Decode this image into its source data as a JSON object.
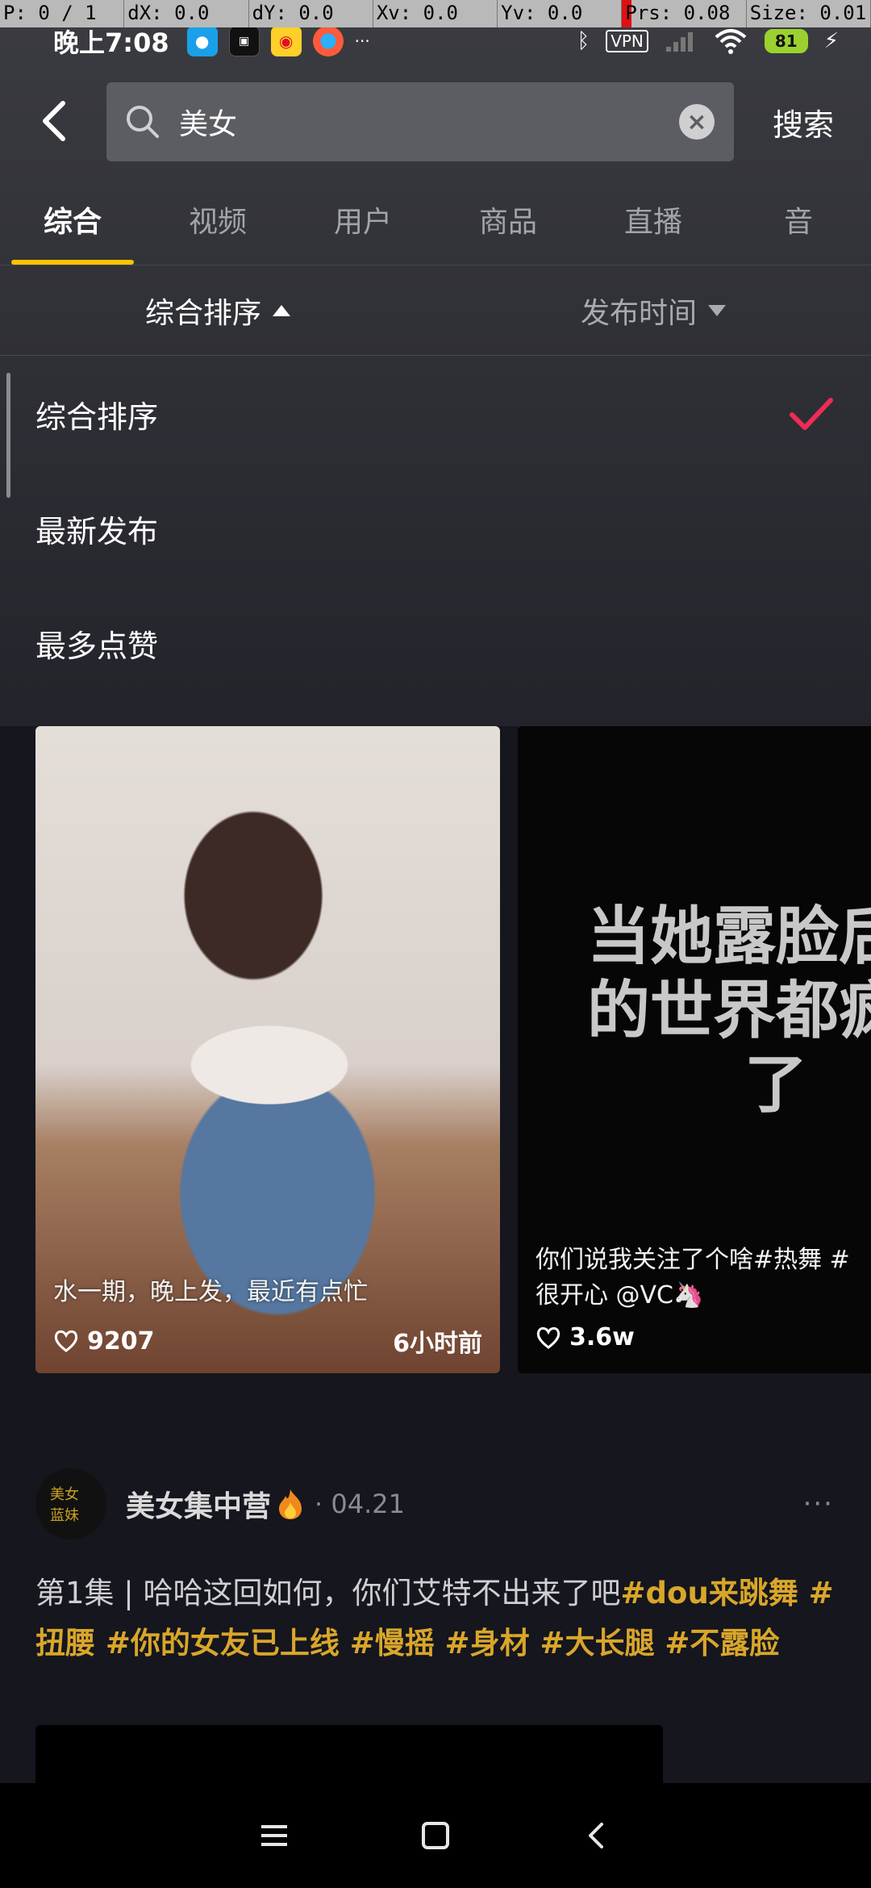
{
  "debug": {
    "p": "P: 0 / 1",
    "dx": "dX: 0.0",
    "dy": "dY: 0.0",
    "xv": "Xv: 0.0",
    "yv": "Yv: 0.0",
    "prs": "Prs: 0.08",
    "size": "Size: 0.01"
  },
  "status_bar": {
    "time": "晚上7:08",
    "vpn": "VPN",
    "battery": "81"
  },
  "search": {
    "query": "美女",
    "button": "搜索"
  },
  "tabs": [
    "综合",
    "视频",
    "用户",
    "商品",
    "直播",
    "音"
  ],
  "sort": {
    "primary": "综合排序",
    "secondary": "发布时间"
  },
  "sort_options": [
    "综合排序",
    "最新发布",
    "最多点赞"
  ],
  "cards": [
    {
      "desc": "水一期，晚上发，最近有点忙",
      "likes": "9207",
      "time": "6小时前"
    },
    {
      "overlay_text": "当她露脸后我的世界都疯狂了",
      "desc_line1": "你们说我关注了个啥#热舞 #",
      "desc_line2": "很开心 @VC🦄",
      "likes": "3.6w"
    }
  ],
  "post": {
    "avatar_text": "美女蓝妹",
    "author": "美女集中营",
    "date": "· 04.21",
    "more": "···",
    "text_plain": "第1集 | 哈哈这回如何，你们艾特不出来了吧",
    "tags": "#dou来跳舞 #扭腰 #你的女友已上线 #慢摇 #身材 #大长腿 #不露脸"
  },
  "colors": {
    "accent": "#ffc300",
    "check": "#ee2c55",
    "tag": "#d9a62a"
  }
}
